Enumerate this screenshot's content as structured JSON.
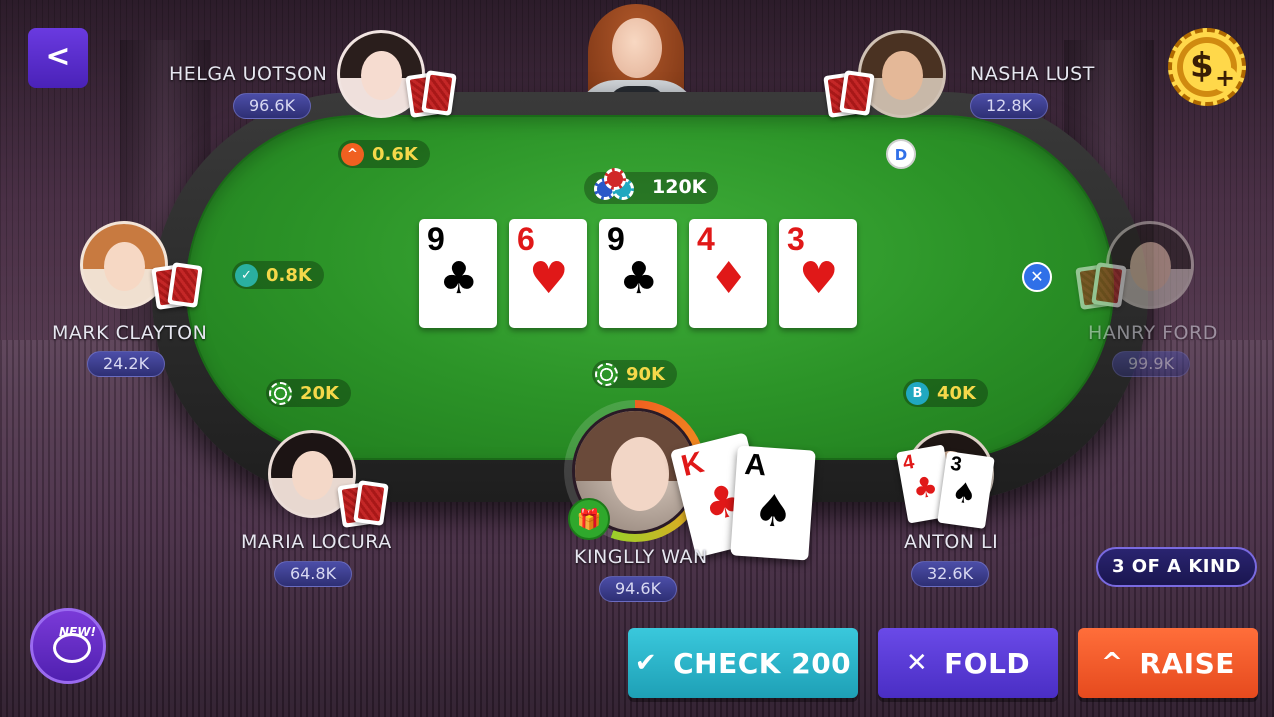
{
  "pot": {
    "amount": "120K"
  },
  "community_cards": [
    {
      "rank": "9",
      "suit": "♣",
      "color": "#111111"
    },
    {
      "rank": "6",
      "suit": "♥",
      "color": "#e01818"
    },
    {
      "rank": "9",
      "suit": "♣",
      "color": "#111111"
    },
    {
      "rank": "4",
      "suit": "♦",
      "color": "#e01818"
    },
    {
      "rank": "3",
      "suit": "♥",
      "color": "#e01818"
    }
  ],
  "players": {
    "helga": {
      "name": "HELGA UOTSON",
      "chips": "96.6K",
      "bet": "0.6K",
      "bet_icon": "^"
    },
    "nasha": {
      "name": "NASHA LUST",
      "chips": "12.8K",
      "dealer_badge": "D"
    },
    "mark": {
      "name": "MARK CLAYTON",
      "chips": "24.2K",
      "bet": "0.8K",
      "bet_icon": "✓"
    },
    "hanry": {
      "name": "HANRY FORD",
      "chips": "99.9K",
      "status_icon": "✕"
    },
    "maria": {
      "name": "MARIA LOCURA",
      "chips": "64.8K",
      "bet": "20K"
    },
    "hero": {
      "name": "KINGLLY WAN",
      "chips": "94.6K",
      "bet": "90K",
      "cards": [
        {
          "rank": "K",
          "suit": "♣",
          "color": "#e01818"
        },
        {
          "rank": "A",
          "suit": "♠",
          "color": "#111111"
        }
      ]
    },
    "anton": {
      "name": "ANTON LI",
      "chips": "32.6K",
      "bet": "40K",
      "bet_icon": "B",
      "cards": [
        {
          "rank": "4",
          "suit": "♣",
          "color": "#e01818"
        },
        {
          "rank": "3",
          "suit": "♠",
          "color": "#111111"
        }
      ]
    }
  },
  "hand_rank": "3 OF A KIND",
  "actions": {
    "check": {
      "glyph": "✔",
      "label": "CHECK 200"
    },
    "fold": {
      "glyph": "✕",
      "label": "FOLD"
    },
    "raise": {
      "glyph": "^",
      "label": "RAISE"
    }
  },
  "nav": {
    "back_glyph": "<",
    "coin_symbol": "$",
    "coin_plus": "+",
    "chat_badge": "NEW!",
    "gift_glyph": "🎁"
  }
}
